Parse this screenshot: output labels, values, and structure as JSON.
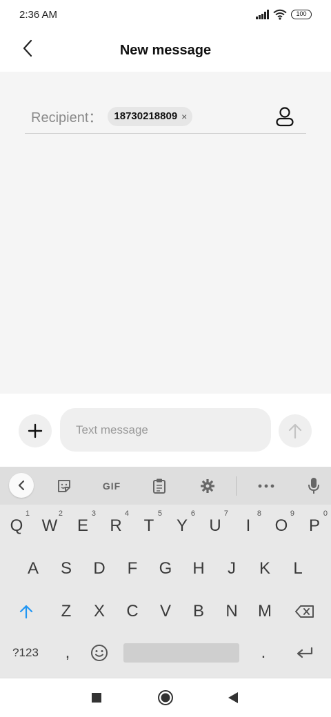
{
  "status_bar": {
    "time": "2:36 AM",
    "battery": "100"
  },
  "header": {
    "title": "New message"
  },
  "recipient": {
    "label": "Recipient：",
    "chip_text": "18730218809",
    "chip_remove": "×"
  },
  "composer": {
    "placeholder": "Text message"
  },
  "keyboard": {
    "toolbar": {
      "gif_label": "GIF"
    },
    "row1": [
      {
        "key": "Q",
        "hint": "1"
      },
      {
        "key": "W",
        "hint": "2"
      },
      {
        "key": "E",
        "hint": "3"
      },
      {
        "key": "R",
        "hint": "4"
      },
      {
        "key": "T",
        "hint": "5"
      },
      {
        "key": "Y",
        "hint": "6"
      },
      {
        "key": "U",
        "hint": "7"
      },
      {
        "key": "I",
        "hint": "8"
      },
      {
        "key": "O",
        "hint": "9"
      },
      {
        "key": "P",
        "hint": "0"
      }
    ],
    "row2": [
      "A",
      "S",
      "D",
      "F",
      "G",
      "H",
      "J",
      "K",
      "L"
    ],
    "row3": [
      "Z",
      "X",
      "C",
      "V",
      "B",
      "N",
      "M"
    ],
    "symbols_label": "?123",
    "comma": ",",
    "period": "."
  },
  "colors": {
    "accent": "#2196f3",
    "compose_bg": "#f5f5f5",
    "keyboard_bg": "#e8e8e8"
  },
  "icons": [
    "back-icon",
    "contact-icon",
    "plus-icon",
    "send-arrow-icon",
    "collapse-icon",
    "sticker-icon",
    "clipboard-icon",
    "gear-icon",
    "more-icon",
    "mic-icon",
    "shift-icon",
    "backspace-icon",
    "emoji-icon",
    "enter-icon",
    "recents-icon",
    "home-icon",
    "back-nav-icon"
  ]
}
